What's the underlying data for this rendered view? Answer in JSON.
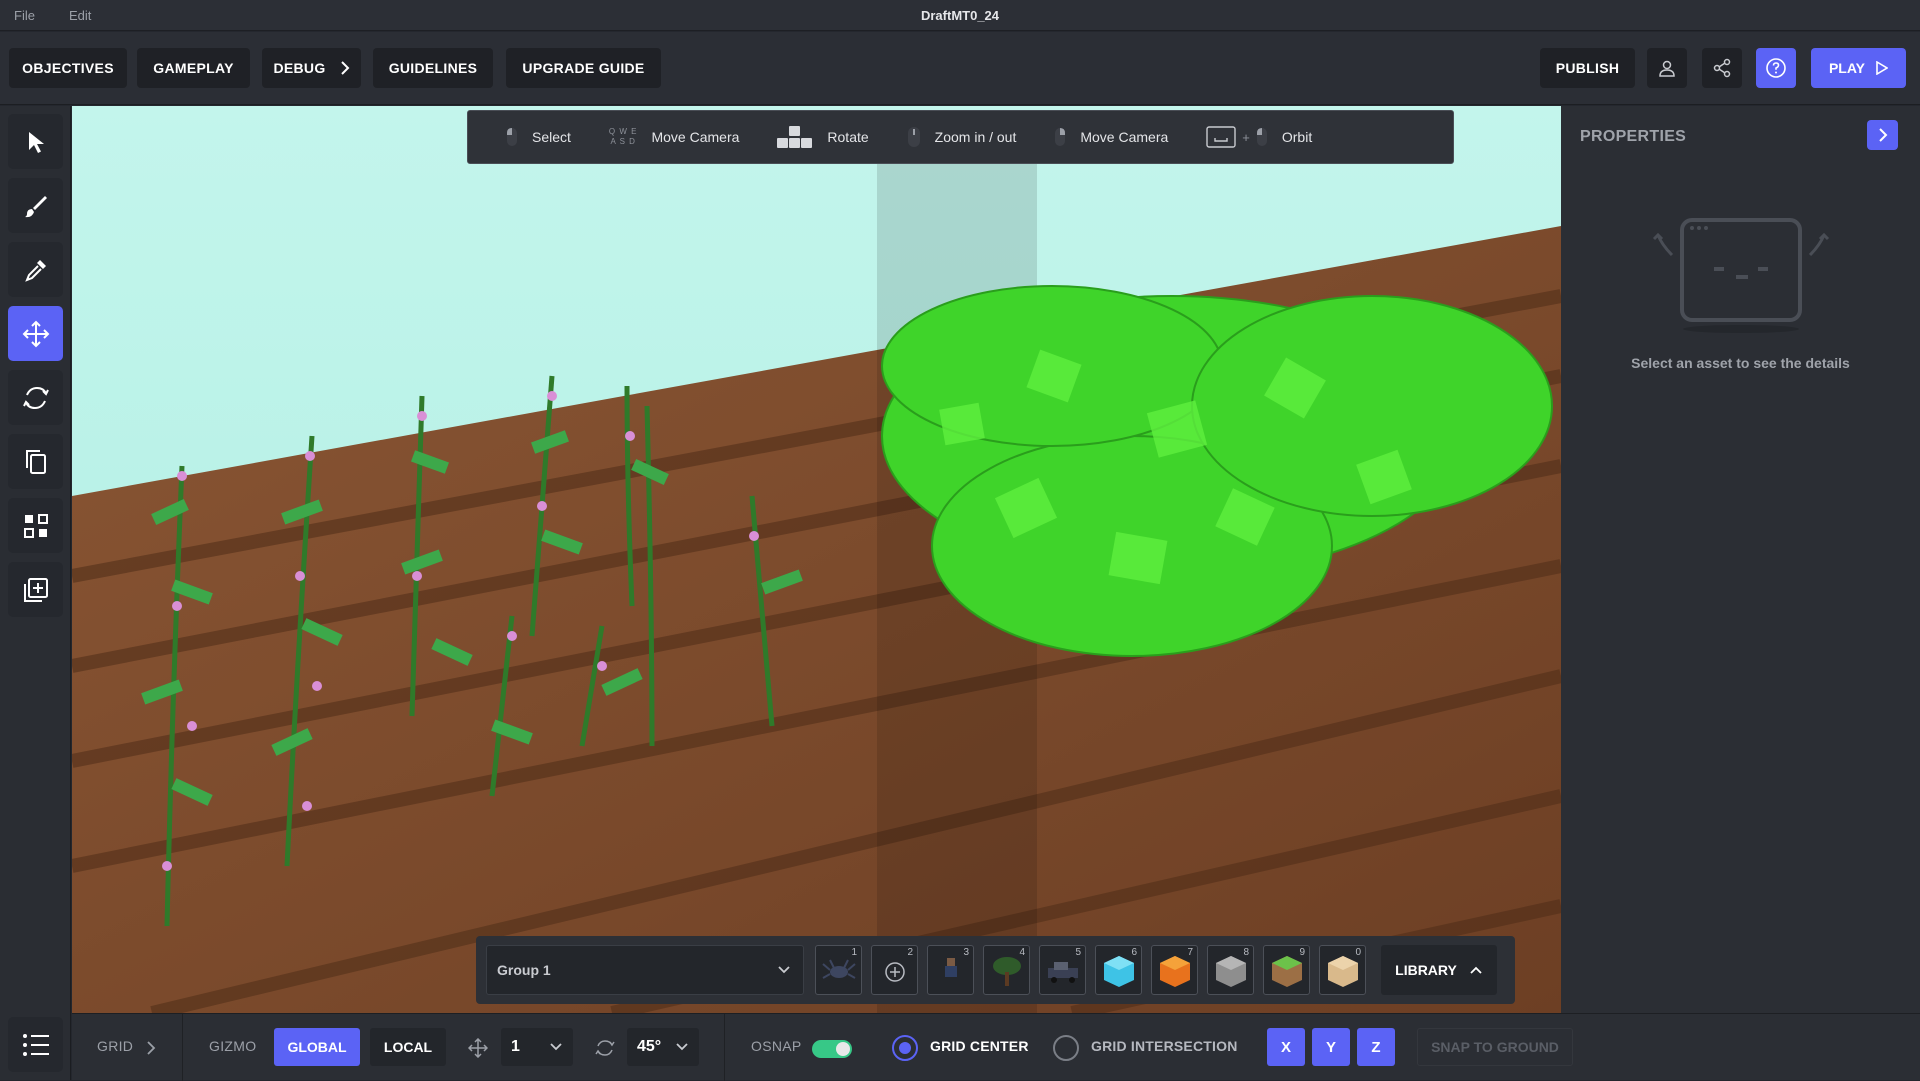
{
  "titlebar": {
    "menu": [
      "File",
      "Edit"
    ],
    "title": "DraftMT0_24"
  },
  "header": {
    "nav": [
      {
        "label": "OBJECTIVES"
      },
      {
        "label": "GAMEPLAY"
      },
      {
        "label": "DEBUG",
        "icon": "chevron-right-icon"
      },
      {
        "label": "GUIDELINES"
      },
      {
        "label": "UPGRADE GUIDE"
      }
    ],
    "publish_label": "PUBLISH",
    "icons": [
      "user-icon",
      "share-icon",
      "help-icon"
    ],
    "play_label": "PLAY"
  },
  "left_tools": [
    "select-cursor-icon",
    "paint-brush-icon",
    "eyedropper-icon",
    "move-icon",
    "rotate-icon",
    "duplicate-icon",
    "group-icon",
    "add-asset-icon",
    "list-icon"
  ],
  "active_tool": "move-icon",
  "hints": [
    {
      "key": "mouse-left-icon",
      "label": "Select"
    },
    {
      "key": "qwe-asd-keys",
      "label": "Move Camera"
    },
    {
      "key": "arrow-keys-icon",
      "label": "Rotate"
    },
    {
      "key": "mouse-scroll-icon",
      "label": "Zoom in / out"
    },
    {
      "key": "mouse-right-icon",
      "label": "Move Camera"
    },
    {
      "key": "space-plus-mouse-icon",
      "label": "Orbit"
    }
  ],
  "hint_keys": {
    "qwe": "Q W E",
    "asd": "A S D",
    "plus": "+"
  },
  "dock": {
    "group_label": "Group 1",
    "slots": [
      {
        "num": "1",
        "icon": "spider-asset-icon"
      },
      {
        "num": "2",
        "icon": "add-circle-icon"
      },
      {
        "num": "3",
        "icon": "character-asset-icon"
      },
      {
        "num": "4",
        "icon": "tree-asset-icon"
      },
      {
        "num": "5",
        "icon": "vehicle-asset-icon"
      },
      {
        "num": "6",
        "icon": "diamond-block-icon"
      },
      {
        "num": "7",
        "icon": "lava-block-icon"
      },
      {
        "num": "8",
        "icon": "stone-block-icon"
      },
      {
        "num": "9",
        "icon": "grass-block-icon"
      },
      {
        "num": "0",
        "icon": "sand-block-icon"
      }
    ],
    "library_label": "LIBRARY"
  },
  "properties": {
    "title": "PROPERTIES",
    "empty_text": "Select an asset to see the details"
  },
  "bottom": {
    "grid_label": "GRID",
    "gizmo_label": "GIZMO",
    "global_label": "GLOBAL",
    "local_label": "LOCAL",
    "move_step": "1",
    "rotate_step": "45°",
    "osnap_label": "OSNAP",
    "osnap_on": true,
    "grid_center_label": "GRID CENTER",
    "grid_intersection_label": "GRID INTERSECTION",
    "axes": [
      "X",
      "Y",
      "Z"
    ],
    "snap_label": "SNAP TO GROUND"
  },
  "colors": {
    "accent": "#5b63f5",
    "toggle_on": "#37c887",
    "sky": "#bff3ea",
    "soil": "#7a4a2c",
    "foliage": "#3fd42a"
  }
}
